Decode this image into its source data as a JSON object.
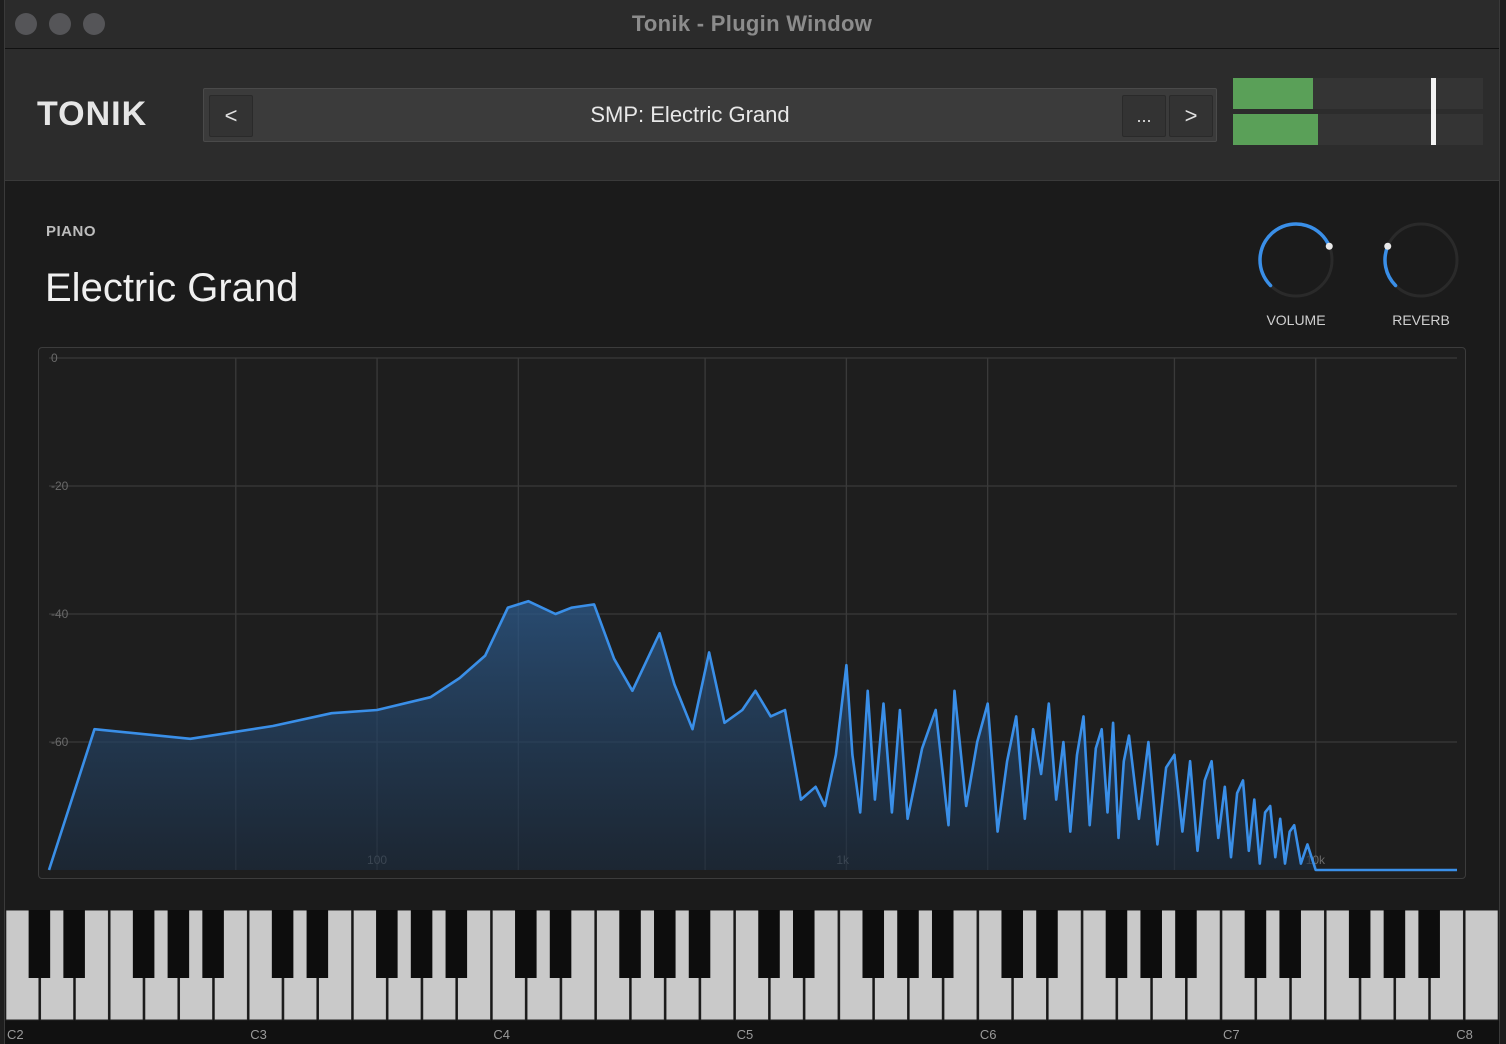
{
  "window": {
    "title": "Tonik - Plugin Window"
  },
  "header": {
    "logo": "TONIK",
    "preset": {
      "prev_label": "<",
      "name": "SMP: Electric Grand",
      "more_label": "...",
      "next_label": ">"
    },
    "meters": {
      "left_level": 0.32,
      "right_level": 0.34,
      "peak_hold": 0.79
    }
  },
  "instrument": {
    "category": "PIANO",
    "name": "Electric Grand"
  },
  "knobs": [
    {
      "label": "VOLUME",
      "value": 0.75,
      "color": "#3a8fe8"
    },
    {
      "label": "REVERB",
      "value": 0.25,
      "color": "#3a8fe8"
    }
  ],
  "chart_data": {
    "type": "area",
    "title": "",
    "xlabel": "",
    "ylabel": "",
    "x_scale": "log",
    "xlim": [
      20,
      20000
    ],
    "ylim": [
      -80,
      0
    ],
    "y_ticks": [
      "0",
      "-20",
      "-40",
      "-60"
    ],
    "x_ticks": [
      "100",
      "1k",
      "10k"
    ],
    "grid": true,
    "color": "#3a8fe8",
    "series": [
      {
        "x": [
          20,
          25,
          40,
          60,
          80,
          100,
          130,
          150,
          170,
          190,
          210,
          240,
          260,
          290,
          320,
          350,
          400,
          430,
          470,
          510,
          550,
          600,
          640,
          690,
          740,
          800,
          860,
          900,
          950,
          1000,
          1030,
          1070,
          1110,
          1150,
          1200,
          1250,
          1300,
          1350,
          1450,
          1550,
          1650,
          1700,
          1800,
          1900,
          2000,
          2100,
          2200,
          2300,
          2400,
          2500,
          2600,
          2700,
          2800,
          2900,
          3000,
          3100,
          3200,
          3300,
          3400,
          3500,
          3600,
          3700,
          3800,
          3900,
          4000,
          4200,
          4400,
          4600,
          4800,
          5000,
          5200,
          5400,
          5600,
          5800,
          6000,
          6200,
          6400,
          6600,
          6800,
          7000,
          7200,
          7400,
          7600,
          7800,
          8000,
          8200,
          8400,
          8600,
          8800,
          9000,
          9300,
          9600,
          10000,
          11000,
          15000,
          20000
        ],
        "y": [
          -80,
          -58,
          -59.5,
          -57.5,
          -55.5,
          -55,
          -53,
          -50,
          -46.5,
          -39,
          -38,
          -40,
          -39,
          -38.5,
          -47,
          -52,
          -43,
          -51,
          -58,
          -46,
          -57,
          -55,
          -52,
          -56,
          -55,
          -69,
          -67,
          -70,
          -62,
          -48,
          -62,
          -71,
          -52,
          -69,
          -54,
          -71,
          -55,
          -72,
          -61,
          -55,
          -73,
          -52,
          -70,
          -60,
          -54,
          -74,
          -63,
          -56,
          -72,
          -58,
          -65,
          -54,
          -69,
          -60,
          -74,
          -62,
          -56,
          -73,
          -61,
          -58,
          -71,
          -57,
          -75,
          -63,
          -59,
          -72,
          -60,
          -76,
          -64,
          -62,
          -74,
          -63,
          -77,
          -66,
          -63,
          -75,
          -67,
          -78,
          -68,
          -66,
          -77,
          -69,
          -79,
          -71,
          -70,
          -78,
          -72,
          -79,
          -74,
          -73,
          -79,
          -76,
          -80,
          -80,
          -80,
          -80
        ]
      }
    ]
  },
  "keyboard": {
    "octave_labels": [
      "C2",
      "C3",
      "C4",
      "C5",
      "C6",
      "C7",
      "C8"
    ]
  }
}
